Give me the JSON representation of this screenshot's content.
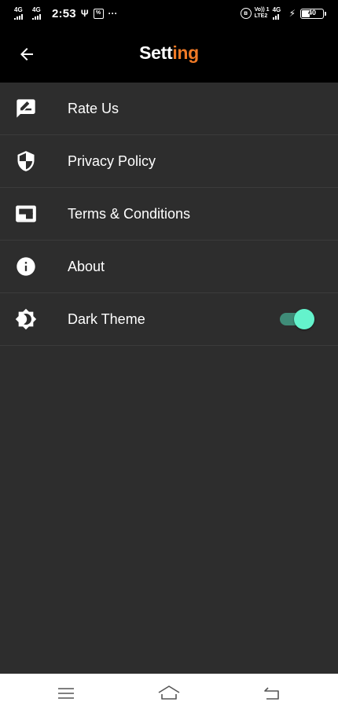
{
  "status_bar": {
    "sim1_network": "4G",
    "sim2_network": "4G",
    "time": "2:53",
    "usb_symbol": "Ψ",
    "notification_box": "%",
    "more_dots": "···",
    "bluetooth_symbol": "ʙ",
    "volte_top": "Vo)) 1",
    "volte_bottom": "LTE2",
    "data_network": "4G",
    "charging_symbol": "⚡",
    "battery_level": "40"
  },
  "app_bar": {
    "title_main": "Sett",
    "title_accent": "ing",
    "back_icon": "arrow-left-icon"
  },
  "menu": {
    "items": [
      {
        "label": "Rate Us",
        "icon": "rate-review-icon"
      },
      {
        "label": "Privacy Policy",
        "icon": "security-shield-icon"
      },
      {
        "label": "Terms & Conditions",
        "icon": "picture-in-picture-icon"
      },
      {
        "label": "About",
        "icon": "info-icon"
      },
      {
        "label": "Dark Theme",
        "icon": "brightness-icon"
      }
    ],
    "dark_theme_enabled": true
  },
  "nav_bar": {
    "menu_icon": "menu-icon",
    "home_icon": "home-icon",
    "back_icon": "back-return-icon"
  },
  "colors": {
    "background": "#2d2d2d",
    "app_bar": "#000000",
    "title_accent": "#f07a26",
    "toggle_track": "#3f8c78",
    "toggle_thumb": "#64f3cc",
    "divider": "#3b3b3b"
  }
}
